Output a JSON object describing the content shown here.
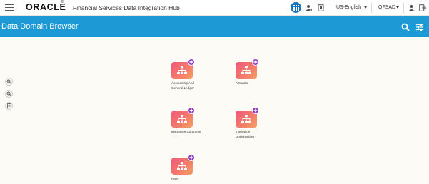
{
  "topbar": {
    "logo": "ORACLE",
    "logo_mark": "®",
    "app_title": "Financial Services Data Integration Hub",
    "language": "US-English",
    "user": "OFSAD",
    "icons": [
      "menu-icon",
      "grid-icon",
      "user-settings-icon",
      "document-icon",
      "user-icon",
      "logout-icon"
    ]
  },
  "header": {
    "title": "Data Domain Browser",
    "icons": [
      "search-icon",
      "filter-icon"
    ]
  },
  "zoom_controls": {
    "icons": [
      "zoom-in-icon",
      "zoom-out-icon",
      "fit-icon"
    ]
  },
  "domains": [
    {
      "label": "Accounting And General Ledger"
    },
    {
      "label": "Actuarial"
    },
    {
      "label": "Insurance Contracts"
    },
    {
      "label": "Insurance Underwriting"
    },
    {
      "label": "Party"
    }
  ],
  "colors": {
    "header": "#1c9ad6",
    "grid_button": "#1a73b9",
    "tile_start": "#f0587d",
    "tile_end": "#f6a061",
    "plus_badge": "#8e3bc8",
    "canvas": "#fcfbf5"
  }
}
